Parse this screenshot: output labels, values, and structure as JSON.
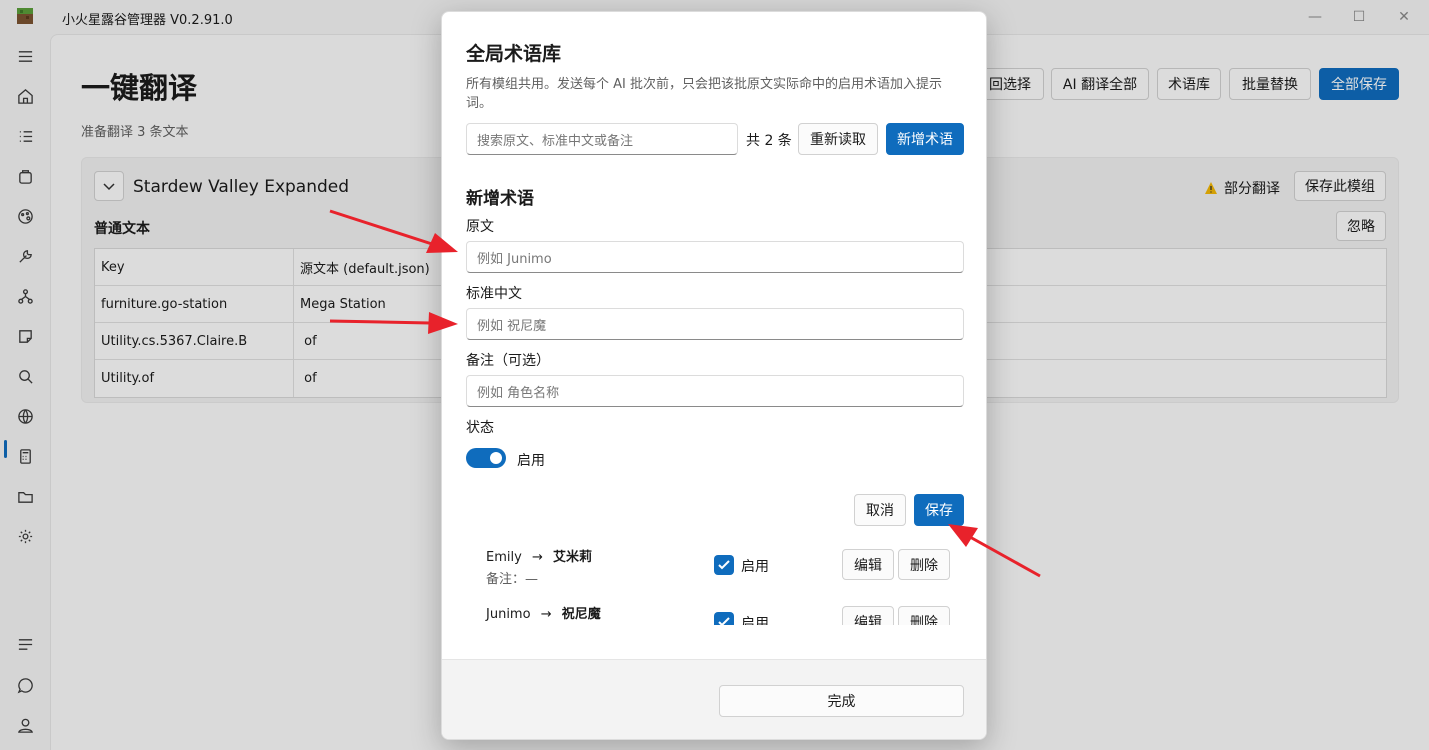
{
  "window": {
    "title": "小火星露谷管理器 V0.2.91.0",
    "controls": [
      "—",
      "☐",
      "✕"
    ]
  },
  "sidebar": {
    "items": [
      {
        "icon": "menu-icon"
      },
      {
        "icon": "home-icon"
      },
      {
        "icon": "list-icon"
      },
      {
        "icon": "bag-icon"
      },
      {
        "icon": "palette-icon"
      },
      {
        "icon": "wrench-icon"
      },
      {
        "icon": "nodes-icon"
      },
      {
        "icon": "sticky-note-icon"
      },
      {
        "icon": "search-icon"
      },
      {
        "icon": "globe-icon",
        "active": true
      },
      {
        "icon": "calculator-icon"
      },
      {
        "icon": "folder-icon"
      },
      {
        "icon": "gear-icon"
      }
    ],
    "bottom_items": [
      {
        "icon": "lines-icon"
      },
      {
        "icon": "chat-icon"
      },
      {
        "icon": "user-icon"
      }
    ]
  },
  "page": {
    "title": "一键翻译",
    "subtitle": "准备翻译 3 条文本",
    "toolbar": {
      "back_select": "回选择",
      "ai_translate_all": "AI 翻译全部",
      "glossary": "术语库",
      "batch_replace": "批量替换",
      "save_all": "全部保存"
    }
  },
  "mod_card": {
    "name": "Stardew Valley Expanded",
    "status": "部分翻译",
    "save_mod": "保存此模组",
    "section": "普通文本",
    "ignore": "忽略",
    "table": {
      "headers": [
        "Key",
        "源文本 (default.json)",
        ""
      ],
      "rows": [
        [
          "furniture.go-station",
          "Mega Station",
          ""
        ],
        [
          "Utility.cs.5367.Claire.B",
          " of",
          ""
        ],
        [
          "Utility.of",
          " of",
          ""
        ]
      ]
    }
  },
  "modal": {
    "title": "全局术语库",
    "description": "所有模组共用。发送每个 AI 批次前，只会把该批原文实际命中的启用术语加入提示词。",
    "search_placeholder": "搜索原文、标准中文或备注",
    "count": "共 2 条",
    "reload": "重新读取",
    "new_term": "新增术语",
    "form": {
      "heading": "新增术语",
      "source_label": "原文",
      "source_placeholder": "例如 Junimo",
      "target_label": "标准中文",
      "target_placeholder": "例如 祝尼魔",
      "note_label": "备注（可选）",
      "note_placeholder": "例如 角色名称",
      "status_label": "状态",
      "toggle_label": "启用",
      "cancel": "取消",
      "save": "保存"
    },
    "terms": [
      {
        "source": "Emily",
        "arrow": "→",
        "target": "艾米莉",
        "note": "备注：—",
        "enabled_label": "启用",
        "edit": "编辑",
        "delete": "删除"
      },
      {
        "source": "Junimo",
        "arrow": "→",
        "target": "祝尼魔",
        "note": "",
        "enabled_label": "启用",
        "edit": "编辑",
        "delete": "删除"
      }
    ],
    "done": "完成"
  },
  "colors": {
    "accent": "#0f6cbd",
    "arrow": "#e8222b",
    "warning": "#f2b705"
  }
}
